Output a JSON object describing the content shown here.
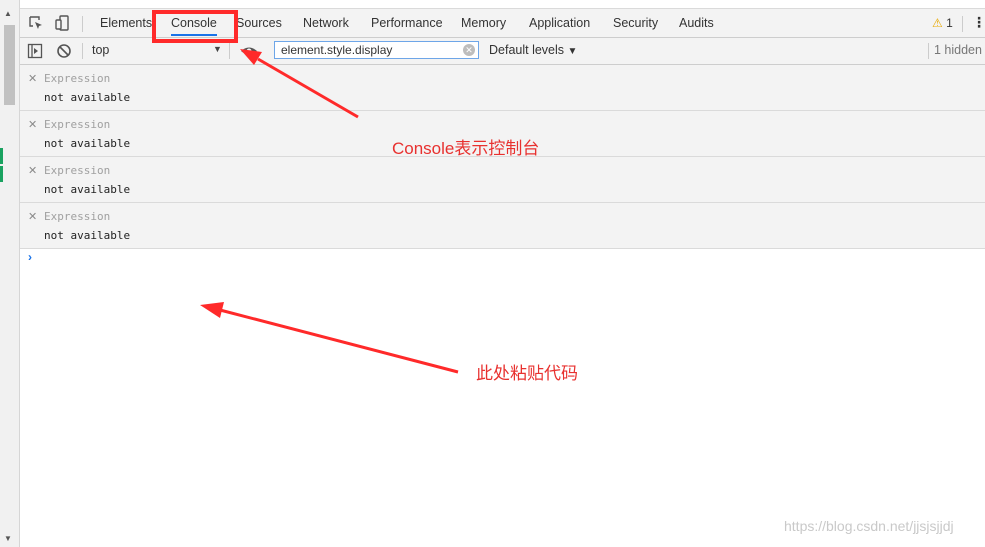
{
  "tabs": [
    "Elements",
    "Console",
    "Sources",
    "Network",
    "Performance",
    "Memory",
    "Application",
    "Security",
    "Audits"
  ],
  "active_tab": "Console",
  "warnings": {
    "count": "1"
  },
  "toolbar": {
    "context": "top",
    "filter_value": "element.style.display",
    "levels_label": "Default levels",
    "hidden_count": "1 hidden"
  },
  "expressions": [
    {
      "label": "Expression",
      "value": "not available"
    },
    {
      "label": "Expression",
      "value": "not available"
    },
    {
      "label": "Expression",
      "value": "not available"
    },
    {
      "label": "Expression",
      "value": "not available"
    }
  ],
  "prompt_symbol": "›",
  "annotations": {
    "console_note": "Console表示控制台",
    "paste_note": "此处粘贴代码"
  },
  "watermark": "https://blog.csdn.net/jjsjsjjdj",
  "colors": {
    "accent_blue": "#1a73e8",
    "annotation_red": "#ff2a2a",
    "warning_yellow": "#e8a800"
  },
  "icons": [
    "inspect-element-icon",
    "device-toolbar-icon",
    "sidebar-toggle-icon",
    "clear-console-icon",
    "eye-icon",
    "warning-icon",
    "more-options-icon",
    "close-icon"
  ]
}
